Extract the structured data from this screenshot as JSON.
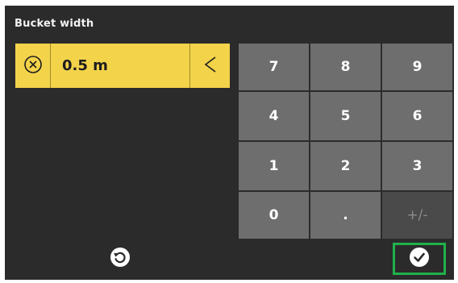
{
  "dialog": {
    "title": "Bucket width"
  },
  "input": {
    "value": "0.5 m",
    "clear_icon": "clear-circle-x-icon",
    "backspace_label": "<"
  },
  "keypad": {
    "keys": [
      "7",
      "8",
      "9",
      "4",
      "5",
      "6",
      "1",
      "2",
      "3",
      "0",
      ".",
      "+/-"
    ]
  },
  "footer": {
    "reset_icon": "reset-icon",
    "confirm_icon": "checkmark-icon"
  },
  "colors": {
    "background": "#2b2b2b",
    "input_bar": "#f3d34a",
    "key": "#6e6e6e",
    "key_disabled": "#4a4a4a",
    "confirm_highlight": "#1fb14b"
  }
}
